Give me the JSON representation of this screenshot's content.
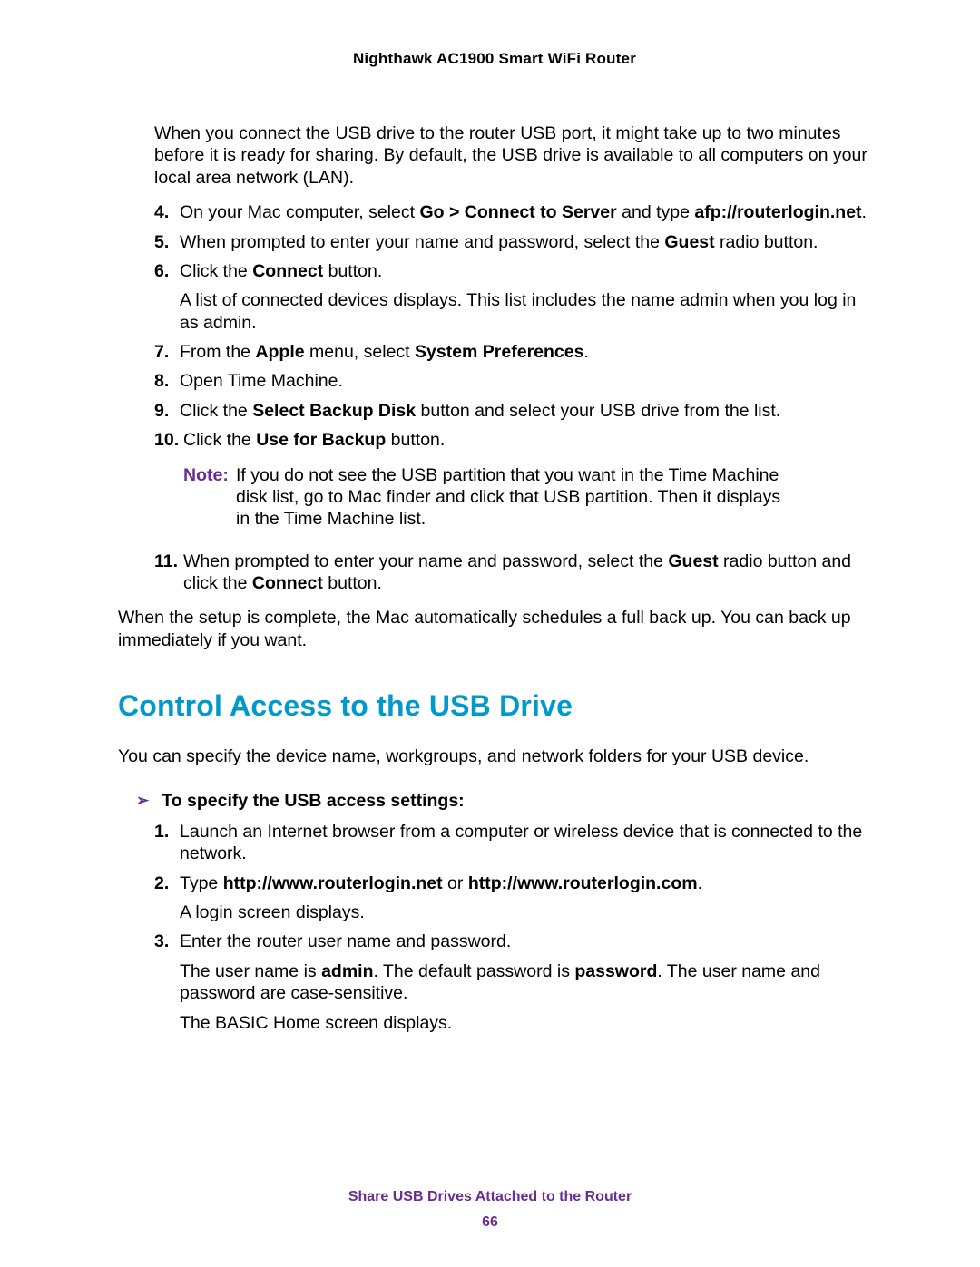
{
  "header": {
    "title": "Nighthawk AC1900 Smart WiFi Router"
  },
  "intro_para": "When you connect the USB drive to the router USB port, it might take up to two minutes before it is ready for sharing. By default, the USB drive is available to all computers on your local area network (LAN).",
  "steps_a": [
    {
      "num": "4.",
      "html": "On your Mac computer, select <b>Go > Connect to Server</b> and type <b>afp://routerlogin.net</b>."
    },
    {
      "num": "5.",
      "html": "When prompted to enter your name and password, select the <b>Guest</b> radio button."
    },
    {
      "num": "6.",
      "html": "Click the <b>Connect</b> button.",
      "after": "A list of connected devices displays. This list includes the name admin when you log in as admin."
    },
    {
      "num": "7.",
      "html": "From the <b>Apple</b> menu, select <b>System Preferences</b>."
    },
    {
      "num": "8.",
      "html": "Open Time Machine."
    },
    {
      "num": "9.",
      "html": "Click the <b>Select Backup Disk</b> button and select your USB drive from the list."
    },
    {
      "num": "10.",
      "html": "Click the <b>Use for Backup</b> button.",
      "wide": true,
      "note": {
        "label": "Note:",
        "text": "If you do not see the USB partition that you want in the Time Machine disk list, go to Mac finder and click that USB partition. Then it displays in the Time Machine list."
      }
    },
    {
      "num": "11.",
      "html": "When prompted to enter your name and password, select the <b>Guest</b> radio button and click the <b>Connect</b> button.",
      "wide": true
    }
  ],
  "conclude": "When the setup is complete, the Mac automatically schedules a full back up. You can back up immediately if you want.",
  "section_heading": "Control Access to the USB Drive",
  "section_intro": "You can specify the device name, workgroups, and network folders for your USB device.",
  "task_heading": "To specify the USB access settings:",
  "steps_b": [
    {
      "num": "1.",
      "html": "Launch an Internet browser from a computer or wireless device that is connected to the network."
    },
    {
      "num": "2.",
      "html": "Type <b>http://www.routerlogin.net</b> or <b>http://www.routerlogin.com</b>.",
      "after": "A login screen displays."
    },
    {
      "num": "3.",
      "html": "Enter the router user name and password.",
      "after_html": "The user name is <b>admin</b>. The default password is <b>password</b>. The user name and password are case-sensitive.",
      "after2": "The BASIC Home screen displays."
    }
  ],
  "footer": {
    "chapter": "Share USB Drives Attached to the Router",
    "page": "66"
  }
}
